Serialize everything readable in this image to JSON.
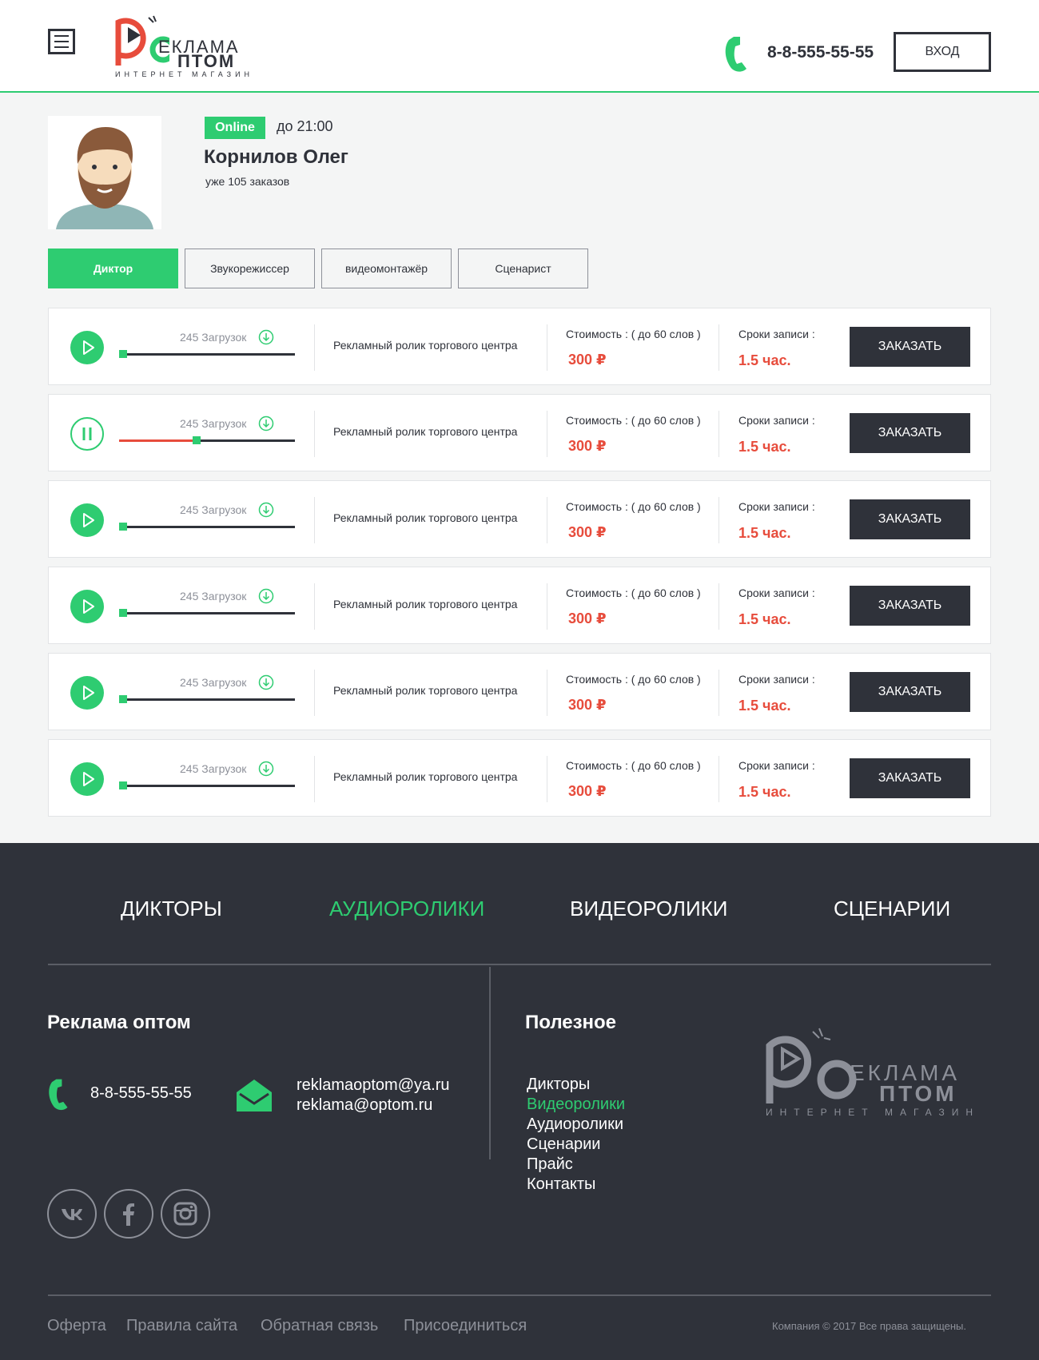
{
  "header": {
    "logo": {
      "letter": "Р",
      "word1": "ЕКЛАМА",
      "word2": "ПТОМ",
      "subtitle": "ИНТЕРНЕТ МАГАЗИН"
    },
    "phone": "8-8-555-55-55",
    "login_label": "ВХОД",
    "accent_color": "#2ecc71",
    "icons": {
      "menu": "hamburger-menu-icon",
      "phone": "phone-icon"
    }
  },
  "profile": {
    "status": "Online",
    "hours": "до 21:00",
    "name": "Корнилов Олег",
    "orders": "уже 105 заказов"
  },
  "tabs": [
    {
      "label": "Диктор",
      "active": true
    },
    {
      "label": "Звукорежиссер",
      "active": false
    },
    {
      "label": "видеомонтажёр",
      "active": false
    },
    {
      "label": "Сценарист",
      "active": false
    }
  ],
  "rows": [
    {
      "state": "stopped",
      "progress": 0,
      "downloads": "245 Загрузок",
      "description": "Рекламный ролик торгового центра",
      "cost_label": "Стоимость :  ( до 60 слов )",
      "cost": "300 ₽",
      "term_label": "Сроки записи :",
      "term": "1.5 час.",
      "order_label": "ЗАКАЗАТЬ"
    },
    {
      "state": "playing",
      "progress": 0.42,
      "downloads": "245 Загрузок",
      "description": "Рекламный ролик торгового центра",
      "cost_label": "Стоимость :  ( до 60 слов )",
      "cost": "300 ₽",
      "term_label": "Сроки записи :",
      "term": "1.5 час.",
      "order_label": "ЗАКАЗАТЬ"
    },
    {
      "state": "stopped",
      "progress": 0,
      "downloads": "245 Загрузок",
      "description": "Рекламный ролик торгового центра",
      "cost_label": "Стоимость :  ( до 60 слов )",
      "cost": "300 ₽",
      "term_label": "Сроки записи :",
      "term": "1.5 час.",
      "order_label": "ЗАКАЗАТЬ"
    },
    {
      "state": "stopped",
      "progress": 0,
      "downloads": "245 Загрузок",
      "description": "Рекламный ролик торгового центра",
      "cost_label": "Стоимость :  ( до 60 слов )",
      "cost": "300 ₽",
      "term_label": "Сроки записи :",
      "term": "1.5 час.",
      "order_label": "ЗАКАЗАТЬ"
    },
    {
      "state": "stopped",
      "progress": 0,
      "downloads": "245 Загрузок",
      "description": "Рекламный ролик торгового центра",
      "cost_label": "Стоимость :  ( до 60 слов )",
      "cost": "300 ₽",
      "term_label": "Сроки записи :",
      "term": "1.5 час.",
      "order_label": "ЗАКАЗАТЬ"
    },
    {
      "state": "stopped",
      "progress": 0,
      "downloads": "245 Загрузок",
      "description": "Рекламный ролик торгового центра",
      "cost_label": "Стоимость :  ( до 60 слов )",
      "cost": "300 ₽",
      "term_label": "Сроки записи :",
      "term": "1.5 час.",
      "order_label": "ЗАКАЗАТЬ"
    }
  ],
  "footer": {
    "nav": [
      {
        "label": "ДИКТОРЫ",
        "active": false
      },
      {
        "label": "АУДИОРОЛИКИ",
        "active": true
      },
      {
        "label": "ВИДЕОРОЛИКИ",
        "active": false
      },
      {
        "label": "СЦЕНАРИИ",
        "active": false
      }
    ],
    "company_title": "Реклама оптом",
    "phone": "8-8-555-55-55",
    "emails": [
      "reklamaoptom@ya.ru",
      "reklama@optom.ru"
    ],
    "useful_title": "Полезное",
    "useful_links": [
      {
        "label": "Дикторы",
        "active": false
      },
      {
        "label": "Видеоролики",
        "active": true
      },
      {
        "label": "Аудиоролики",
        "active": false
      },
      {
        "label": "Сценарии",
        "active": false
      },
      {
        "label": "Прайс",
        "active": false
      },
      {
        "label": "Контакты",
        "active": false
      }
    ],
    "logo": {
      "letter": "Р",
      "word1": "ЕКЛАМА",
      "word2": "ПТОМ",
      "subtitle": "ИНТЕРНЕТ МАГАЗИН"
    },
    "social": [
      {
        "icon": "vk-icon",
        "glyph": "vk"
      },
      {
        "icon": "facebook-icon",
        "glyph": "f"
      },
      {
        "icon": "instagram-icon",
        "glyph": "◘"
      }
    ],
    "bottom_links": [
      "Оферта",
      "Правила сайта",
      "Обратная связь",
      "Присоединиться"
    ],
    "copyright": "Компания © 2017  Все права защищены."
  }
}
